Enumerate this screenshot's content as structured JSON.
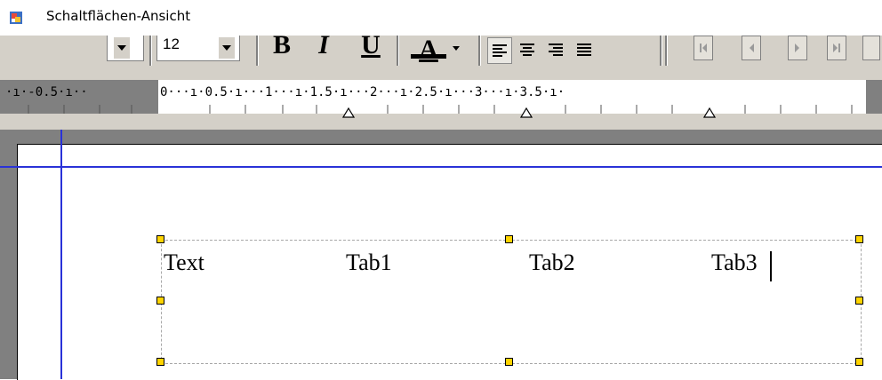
{
  "window": {
    "title": "Schaltflächen-Ansicht",
    "icon": "app-document-icon"
  },
  "toolbar": {
    "font_size_value": "12",
    "bold_label": "B",
    "italic_label": "I",
    "underline_label": "U",
    "font_color_label": "A",
    "icons": [
      "chevron-down-icon",
      "align-left-icon",
      "align-center-icon",
      "align-right-icon",
      "justify-icon",
      "first-record-icon",
      "previous-record-icon",
      "next-record-icon",
      "last-record-icon"
    ]
  },
  "ruler": {
    "left_gray_text": "·ı·-0.5·ı··",
    "white_text": "0···ı·0.5·ı···1···ı·1.5·ı···2···ı·2.5·ı···3···ı·3.5·ı·"
  },
  "frame": {
    "texts": [
      "Text",
      "Tab1",
      "Tab2",
      "Tab3"
    ]
  },
  "colors": {
    "guide_line": "#2a32d8",
    "handle": "#ffd400",
    "chrome": "#d4d0c8"
  }
}
